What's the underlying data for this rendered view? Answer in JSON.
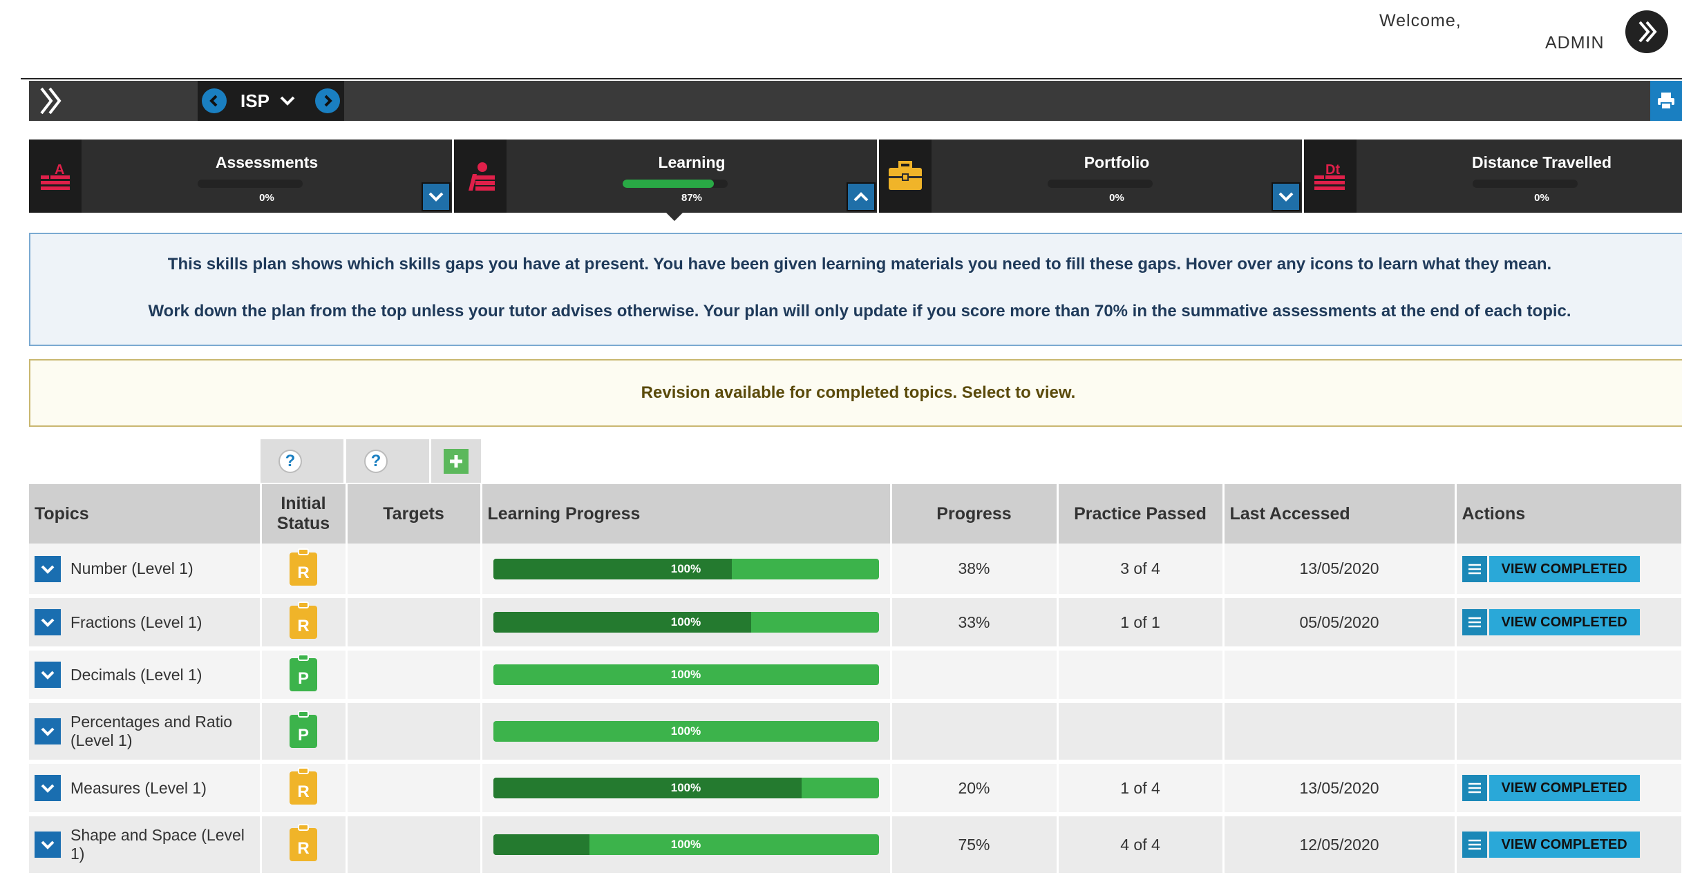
{
  "header": {
    "welcome": "Welcome,",
    "username": "ADMIN"
  },
  "toolbar": {
    "plan_select": "ISP"
  },
  "modules": [
    {
      "title": "Assessments",
      "progress_label": "0%",
      "progress": 0,
      "icon": "assessment-icon",
      "toggle": "expand"
    },
    {
      "title": "Learning",
      "progress_label": "87%",
      "progress": 87,
      "icon": "learning-icon",
      "toggle": "collapse",
      "active": true
    },
    {
      "title": "Portfolio",
      "progress_label": "0%",
      "progress": 0,
      "icon": "briefcase-icon",
      "toggle": "expand"
    },
    {
      "title": "Distance Travelled",
      "progress_label": "0%",
      "progress": 0,
      "icon": "distance-travelled-icon"
    }
  ],
  "info": {
    "line1": "This skills plan shows which skills gaps you have at present. You have been given learning materials you need to fill these gaps. Hover over any icons to learn what they mean.",
    "line2": "Work down the plan from the top unless your tutor advises otherwise. Your plan will only update if you score more than 70% in the summative assessments at the end of each topic."
  },
  "revision_notice": "Revision available for completed topics. Select to view.",
  "filters": {
    "help_glyph": "?",
    "add_glyph": "+"
  },
  "table": {
    "headers": {
      "topics": "Topics",
      "initial_status_1": "Initial",
      "initial_status_2": "Status",
      "targets": "Targets",
      "learning_progress": "Learning Progress",
      "progress": "Progress",
      "practice_passed": "Practice Passed",
      "last_accessed": "Last Accessed",
      "actions": "Actions"
    },
    "rows": [
      {
        "topic": "Number (Level 1)",
        "status": "R",
        "status_color": "#f0b429",
        "lp_label": "100%",
        "lp_dark": 0.62,
        "progress": "38%",
        "practice": "3 of 4",
        "last": "13/05/2020",
        "action": "VIEW COMPLETED"
      },
      {
        "topic": "Fractions (Level 1)",
        "status": "R",
        "status_color": "#f0b429",
        "lp_label": "100%",
        "lp_dark": 0.67,
        "progress": "33%",
        "practice": "1 of 1",
        "last": "05/05/2020",
        "action": "VIEW COMPLETED"
      },
      {
        "topic": "Decimals (Level 1)",
        "status": "P",
        "status_color": "#3cb34b",
        "lp_label": "100%",
        "lp_dark": 0,
        "progress": "",
        "practice": "",
        "last": "",
        "action": ""
      },
      {
        "topic": "Percentages and Ratio (Level 1)",
        "status": "P",
        "status_color": "#3cb34b",
        "lp_label": "100%",
        "lp_dark": 0,
        "progress": "",
        "practice": "",
        "last": "",
        "action": ""
      },
      {
        "topic": "Measures (Level 1)",
        "status": "R",
        "status_color": "#f0b429",
        "lp_label": "100%",
        "lp_dark": 0.8,
        "progress": "20%",
        "practice": "1 of 4",
        "last": "13/05/2020",
        "action": "VIEW COMPLETED"
      },
      {
        "topic": "Shape and Space (Level 1)",
        "status": "R",
        "status_color": "#f0b429",
        "lp_label": "100%",
        "lp_dark": 0.25,
        "progress": "75%",
        "practice": "4 of 4",
        "last": "12/05/2020",
        "action": "VIEW COMPLETED"
      }
    ]
  },
  "colors": {
    "accent": "#1a7fc1",
    "module_icon_red": "#e0204a",
    "portfolio_yellow": "#f0b429",
    "progress_green": "#3cb34b",
    "progress_dark_green": "#247a2f"
  }
}
